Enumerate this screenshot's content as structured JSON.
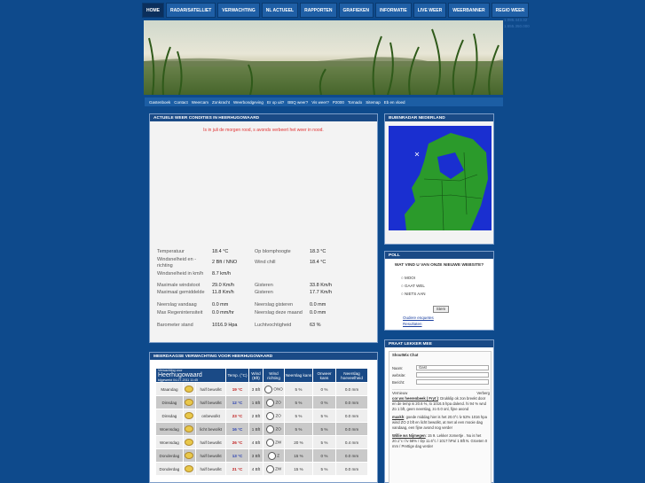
{
  "nav": {
    "items": [
      "HOME",
      "RADAR/SATELLIET",
      "VERWACHTING",
      "NL ACTUEEL",
      "RAPPORTEN",
      "GRAFIEKEN",
      "INFORMATIE",
      "LIVE WEER",
      "WEERBANNER",
      "REGIO WEER"
    ]
  },
  "side_numbers": [
    "1.085.443.32",
    "1.555.350.000"
  ],
  "subnav": [
    "Gastenboek",
    "Contact",
    "Weercam",
    "Zonkracht",
    "Weerbondgeving",
    "Er op uit?",
    "BBQ weer?",
    "Vis weer?",
    "P2000",
    "Tornado",
    "Sitemap",
    "Eb en vloed"
  ],
  "actual": {
    "title": "ACTUELE WEER CONDITIES IN HEERHUGOWAARD",
    "note": "Is in juli de morgen rood, s avonds verbeert het weer in nood.",
    "left_rows": [
      {
        "label": "Temperatuur",
        "value": "18.4 °C"
      },
      {
        "label": "Windsnelheid en -richting",
        "value": "2 Bft / NNO"
      },
      {
        "label": "Windsnelheid in km/h",
        "value": "8.7 km/h"
      },
      {
        "label": "Maximale windstoot",
        "value": "29.0  Km/h"
      },
      {
        "label": "Maximaal gemiddelde",
        "value": "11.8  Km/h"
      },
      {
        "label": "Neerslag vandaag",
        "value": "0.0  mm"
      },
      {
        "label": "Max Regenintensiteit",
        "value": "0.0  mm/hr"
      },
      {
        "label": "Barometer stand",
        "value": "1016.9 Hpa"
      }
    ],
    "right_rows": [
      {
        "label": "Op blomphoogte",
        "value": "18.3 °C"
      },
      {
        "label": "Wind chill",
        "value": "18.4 °C"
      },
      {
        "label": "Gisteren",
        "value": "33.8 Km/h"
      },
      {
        "label": "Gisteren",
        "value": "17.7 Km/h"
      },
      {
        "label": "Neerslag gisteren",
        "value": "0.0  mm"
      },
      {
        "label": "Neerslag deze maand",
        "value": "0.0  mm"
      },
      {
        "label": "Luchtvochtigheid",
        "value": "63 %"
      }
    ]
  },
  "radar": {
    "title": "BUIENRADAR NEDERLAND"
  },
  "poll": {
    "title": "POLL",
    "question": "WAT VIND U VAN ONZE NIEUWE WEBSITE?",
    "options": [
      "MOOI",
      "GAAT WEL",
      "NIETS AAN"
    ],
    "button": "Stem",
    "links": [
      "Oudere enquetes",
      "Resultaten"
    ]
  },
  "chat": {
    "title": "PRAAT LEKKER MEE",
    "header": "ShoutMix Chat",
    "name_label": "Naam:",
    "name_value": "Gast",
    "site_label": "website:",
    "msg_label": "Bericht:",
    "tab1": "Vernieuw",
    "tab2": "Verberg",
    "posts": [
      {
        "name": "cor ws heerenbeek ( Fryt )",
        "text": ": Drukklip ok zon breekt door en de temp is 20.6 %, lo 1016.5 hpa dalend. hi 94 % wnd Zo 1 bft, geen neerslag, zo 0.0 onl, fijne avond"
      },
      {
        "name": "maxkh",
        "text": ": goede middag hier is het 20.0°c lv 52% 1016 hpa wind ZO 2 bft en licht bewolkt, at met al een mooie dag vandaag, een fijne avond nog verder"
      },
      {
        "name": "Willie ws Nijmegen",
        "text": ": 15 9. Lekker zomertje . Nu is het 20.1°c / lv 58% / Dp 11.6°c / 1017 hPa/ 1 Bft N. Groeten 0 mm / Prettige dag verder"
      }
    ]
  },
  "forecast": {
    "title": "MEERDAAGSE VERWACHTING VOOR HEERHUGOWAARD",
    "place_small": "Verwachting voor",
    "place": "Heerhugowaard",
    "updated": "bijgewerkt 04-07-2011 11:45",
    "headers": [
      "Temp. (°C)",
      "Wind (Bft)",
      "Wind richting",
      "Neerslag kans",
      "Onweer kans",
      "Neerslag hoeveelheid"
    ],
    "rows": [
      {
        "day": "Maandag",
        "desc": "half bewolkt",
        "temp": "19 °C",
        "bft": "3 Bft",
        "dir": "ONO",
        "rain": "5 %",
        "storm": "0 %",
        "amount": "0.0 mm"
      },
      {
        "day": "Dinsdag",
        "desc": "half bewolkt",
        "temp": "12 °C",
        "bft": "1 Bft",
        "dir": "ZO",
        "rain": "5 %",
        "storm": "0 %",
        "amount": "0.0 mm"
      },
      {
        "day": "Dinsdag",
        "desc": "onbewolkt",
        "temp": "23 °C",
        "bft": "2 Bft",
        "dir": "ZO",
        "rain": "5 %",
        "storm": "5 %",
        "amount": "0.0 mm"
      },
      {
        "day": "Woensdag",
        "desc": "licht bewolkt",
        "temp": "16 °C",
        "bft": "1 Bft",
        "dir": "ZO",
        "rain": "5 %",
        "storm": "5 %",
        "amount": "0.0 mm"
      },
      {
        "day": "Woensdag",
        "desc": "half bewolkt",
        "temp": "26 °C",
        "bft": "4 Bft",
        "dir": "ZW",
        "rain": "20 %",
        "storm": "5 %",
        "amount": "0.4 mm"
      },
      {
        "day": "Donderdag",
        "desc": "half bewolkt",
        "temp": "13 °C",
        "bft": "3 Bft",
        "dir": "Z",
        "rain": "15 %",
        "storm": "0 %",
        "amount": "0.0 mm"
      },
      {
        "day": "Donderdag",
        "desc": "half bewolkt",
        "temp": "21 °C",
        "bft": "4 Bft",
        "dir": "ZW",
        "rain": "15 %",
        "storm": "5 %",
        "amount": "0.0 mm"
      }
    ]
  }
}
